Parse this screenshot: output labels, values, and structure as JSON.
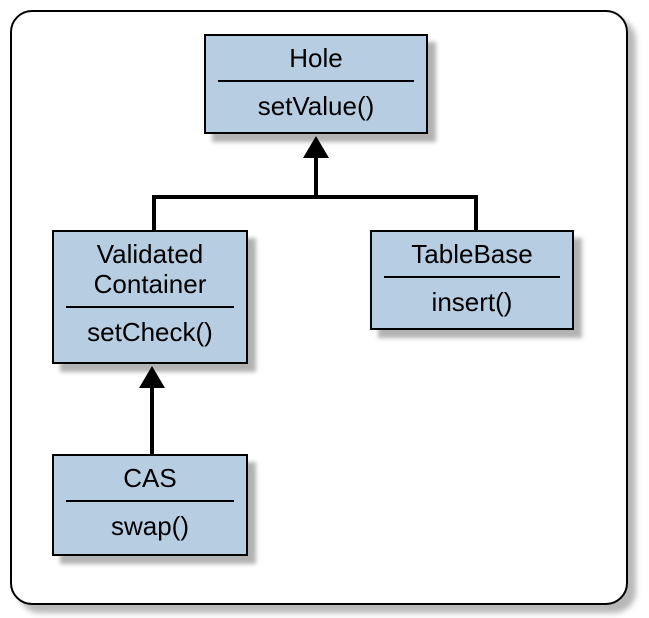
{
  "chart_data": {
    "type": "diagram",
    "diagram_type": "uml-class-hierarchy",
    "classes": [
      {
        "id": "hole",
        "name": "Hole",
        "methods": [
          "setValue()"
        ]
      },
      {
        "id": "validated_container",
        "name": "Validated Container",
        "methods": [
          "setCheck()"
        ],
        "extends": "hole"
      },
      {
        "id": "table_base",
        "name": "TableBase",
        "methods": [
          "insert()"
        ],
        "extends": "hole"
      },
      {
        "id": "cas",
        "name": "CAS",
        "methods": [
          "swap()"
        ],
        "extends": "validated_container"
      }
    ]
  },
  "boxes": {
    "hole": {
      "name": "Hole",
      "method": "setValue()"
    },
    "validated_container": {
      "name_line1": "Validated",
      "name_line2": "Container",
      "method": "setCheck()"
    },
    "table_base": {
      "name": "TableBase",
      "method": "insert()"
    },
    "cas": {
      "name": "CAS",
      "method": "swap()"
    }
  }
}
